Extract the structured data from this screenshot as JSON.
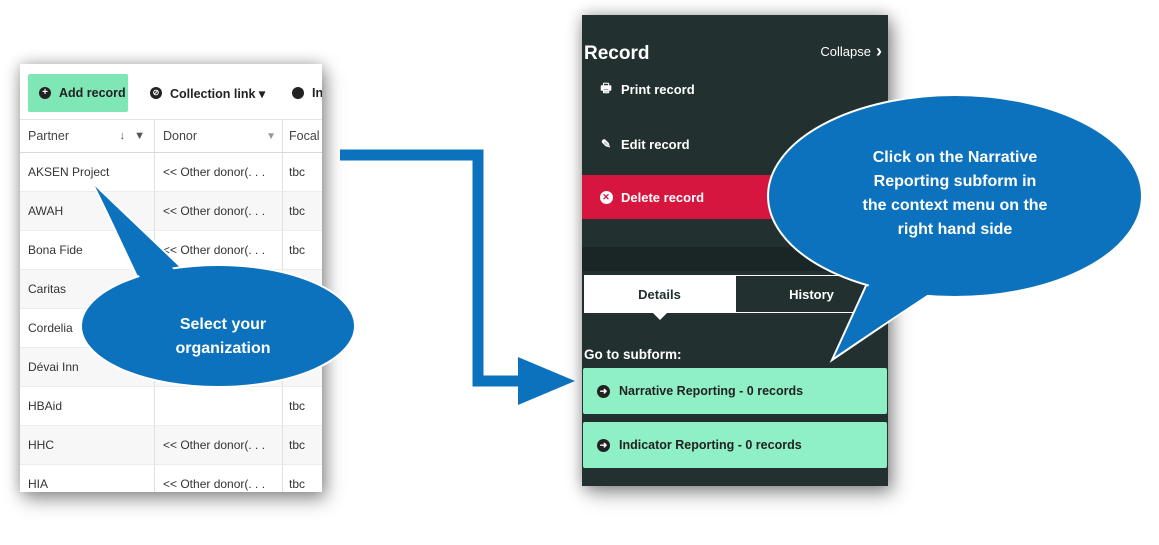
{
  "left_table": {
    "toolbar": {
      "add_record_label": "Add record",
      "add_record_icon": "plus-circle-icon",
      "collection_link_label": "Collection link ▾",
      "collection_link_icon": "link-icon",
      "third_button_label": "In",
      "third_button_icon": "circle-icon"
    },
    "columns": [
      "Partner",
      "Donor",
      "Focal"
    ],
    "partner_sort_indicator": "↓ ▼",
    "donor_filter_indicator": "▼",
    "rows": [
      {
        "partner": "AKSEN Project",
        "donor": "<< Other donor(. . .",
        "focal": "tbc"
      },
      {
        "partner": "AWAH",
        "donor": "<< Other donor(. . .",
        "focal": "tbc"
      },
      {
        "partner": "Bona Fide",
        "donor": "<< Other donor(. . .",
        "focal": "tbc"
      },
      {
        "partner": "Caritas",
        "donor": "",
        "focal": ""
      },
      {
        "partner": "Cordelia",
        "donor": "",
        "focal": ""
      },
      {
        "partner": "Dévai Inn",
        "donor": "",
        "focal": ""
      },
      {
        "partner": "HBAid",
        "donor": "",
        "focal": "tbc"
      },
      {
        "partner": "HHC",
        "donor": "<< Other donor(. . .",
        "focal": "tbc"
      },
      {
        "partner": "HIA",
        "donor": "<< Other donor(. . .",
        "focal": "tbc"
      }
    ]
  },
  "record_panel": {
    "title": "Record",
    "collapse_label": "Collapse",
    "menu": {
      "print_label": "Print record",
      "edit_label": "Edit record",
      "delete_label": "Delete record"
    },
    "tabs": {
      "details": "Details",
      "history": "History"
    },
    "goto_label": "Go to subform:",
    "subforms": [
      {
        "label": "Narrative Reporting - 0 records"
      },
      {
        "label": "Indicator Reporting - 0 records"
      }
    ]
  },
  "callouts": {
    "left_line1": "Select your",
    "left_line2": "organization",
    "right_line1": "Click on the Narrative",
    "right_line2": "Reporting subform in",
    "right_line3": "the context menu on the",
    "right_line4": "right hand side"
  },
  "colors": {
    "accent_green": "#7fe6b6",
    "panel_dark": "#223030",
    "delete_red": "#d6163f",
    "callout_blue": "#0d72bd"
  }
}
